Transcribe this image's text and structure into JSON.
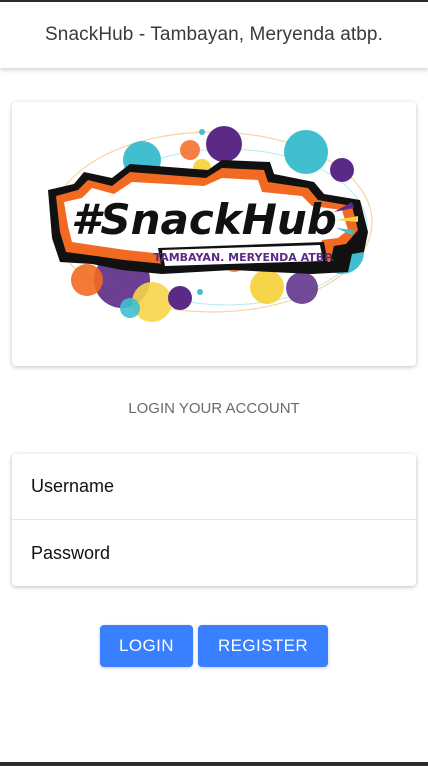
{
  "header": {
    "title": "SnackHub - Tambayan, Meryenda atbp."
  },
  "logo": {
    "brand_text": "#SnackHub",
    "tagline": "TAMBAYAN. MERYENDA ATBP.",
    "colors": {
      "orange": "#f26a21",
      "purple": "#5b2a86",
      "teal": "#41bfd0",
      "yellow": "#f7d54a",
      "black": "#111111"
    }
  },
  "login": {
    "heading": "LOGIN YOUR ACCOUNT",
    "username_placeholder": "Username",
    "password_placeholder": "Password",
    "login_label": "LOGIN",
    "register_label": "REGISTER"
  },
  "theme": {
    "primary": "#3880ff"
  }
}
